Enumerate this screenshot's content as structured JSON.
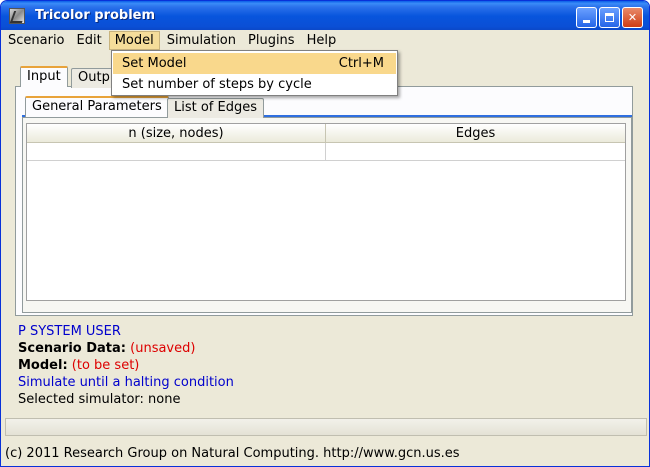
{
  "window": {
    "title": "Tricolor problem"
  },
  "menubar": {
    "items": [
      {
        "label": "Scenario"
      },
      {
        "label": "Edit"
      },
      {
        "label": "Model"
      },
      {
        "label": "Simulation"
      },
      {
        "label": "Plugins"
      },
      {
        "label": "Help"
      }
    ]
  },
  "model_menu": {
    "items": [
      {
        "label": "Set Model",
        "accelerator": "Ctrl+M"
      },
      {
        "label": "Set number of steps by cycle",
        "accelerator": ""
      }
    ]
  },
  "outer_tabs": [
    {
      "label": "Input"
    },
    {
      "label": "Outp"
    }
  ],
  "inner_tabs": [
    {
      "label": "General Parameters"
    },
    {
      "label": "List of Edges"
    }
  ],
  "table": {
    "columns": [
      "n (size, nodes)",
      "Edges"
    ],
    "rows": [
      [
        "",
        ""
      ]
    ]
  },
  "info": {
    "psystem": "P SYSTEM USER",
    "scenario_label": "Scenario Data:",
    "scenario_value": "(unsaved)",
    "model_label": "Model:",
    "model_value": "(to be set)",
    "simulate": "Simulate until a halting condition",
    "simulator": "Selected simulator: none"
  },
  "footer": {
    "text": "(c) 2011 Research Group on Natural Computing. http://www.gcn.us.es"
  },
  "colors": {
    "titlebar": "#0855dd",
    "menu_highlight": "#f9d88c",
    "info_blue": "#0000cc",
    "info_red": "#dd0000"
  }
}
